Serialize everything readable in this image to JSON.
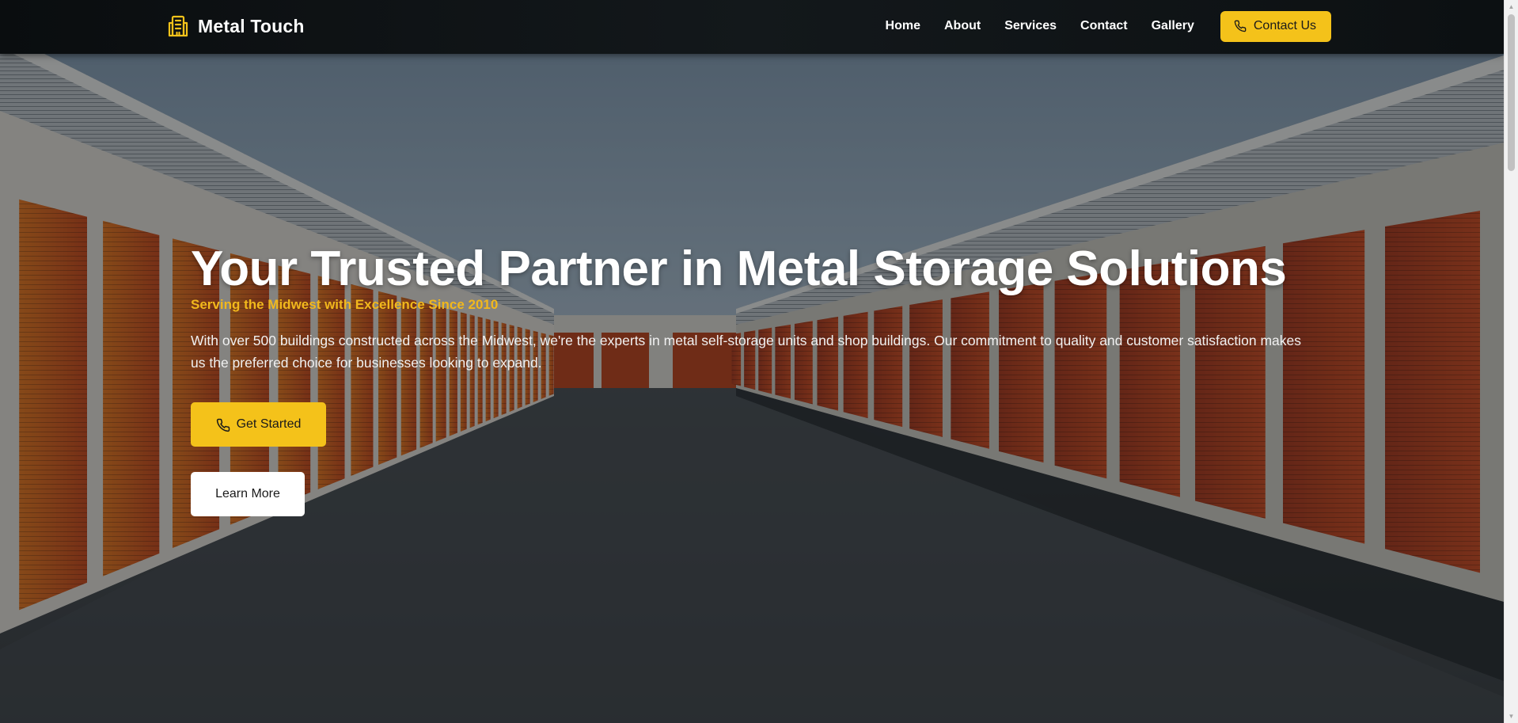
{
  "brand": {
    "name": "Metal Touch",
    "icon": "building-icon",
    "accent_color": "#f4c21a"
  },
  "nav": {
    "links": [
      "Home",
      "About",
      "Services",
      "Contact",
      "Gallery"
    ],
    "cta_label": "Contact Us",
    "cta_icon": "phone-icon"
  },
  "hero": {
    "title": "Your Trusted Partner in Metal Storage Solutions",
    "subtitle": "Serving the Midwest with Excellence Since 2010",
    "text": "With over 500 buildings constructed across the Midwest, we're the experts in metal self-storage units and shop buildings. Our commitment to quality and customer satisfaction makes us the preferred choice for businesses looking to expand.",
    "primary_button": "Get Started",
    "primary_icon": "phone-icon",
    "secondary_button": "Learn More",
    "background_image": "self-storage-units-alley"
  },
  "colors": {
    "accent": "#f4c21a",
    "subtitle": "#f2b81c",
    "navbar": "#0f1316",
    "door_orange": "#c84b1c"
  }
}
